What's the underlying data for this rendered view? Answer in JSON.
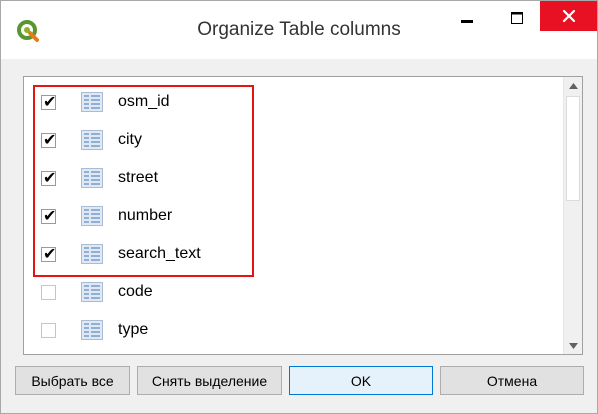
{
  "window": {
    "title": "Organize Table columns",
    "app_icon": "qgis-logo-icon",
    "buttons": {
      "minimize": "minimize-icon",
      "maximize": "maximize-icon",
      "close": "close-icon"
    }
  },
  "columns": [
    {
      "label": "osm_id",
      "checked": true
    },
    {
      "label": "city",
      "checked": true
    },
    {
      "label": "street",
      "checked": true
    },
    {
      "label": "number",
      "checked": true
    },
    {
      "label": "search_text",
      "checked": true
    },
    {
      "label": "code",
      "checked": false
    },
    {
      "label": "type",
      "checked": false
    }
  ],
  "footer": {
    "select_all": "Выбрать все",
    "deselect": "Снять выделение",
    "ok": "OK",
    "cancel": "Отмена"
  },
  "colors": {
    "close_button": "#e81123",
    "highlight_box": "#e41414",
    "ok_border": "#0078d7"
  }
}
